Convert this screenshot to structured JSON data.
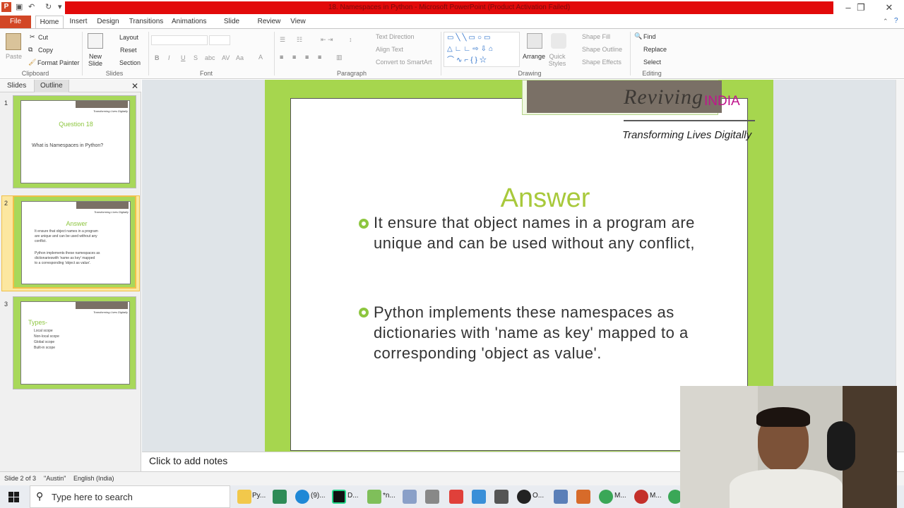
{
  "window": {
    "title": "18. Namespaces in Python - Microsoft PowerPoint (Product Activation Failed)"
  },
  "tabs": [
    "File",
    "Home",
    "Insert",
    "Design",
    "Transitions",
    "Animations",
    "Slide Show",
    "Review",
    "View"
  ],
  "ribbon": {
    "clipboard": {
      "paste": "Paste",
      "cut": "Cut",
      "copy": "Copy",
      "format_painter": "Format Painter",
      "group": "Clipboard"
    },
    "slides": {
      "new_slide": "New Slide",
      "layout": "Layout",
      "reset": "Reset",
      "section": "Section",
      "group": "Slides"
    },
    "font": {
      "group": "Font",
      "bold": "B",
      "italic": "I",
      "underline": "U",
      "strike": "S",
      "shadow": "abc",
      "spacing": "AV",
      "case": "Aa",
      "color": "A"
    },
    "paragraph": {
      "text_direction": "Text Direction",
      "align_text": "Align Text",
      "convert_smartart": "Convert to SmartArt",
      "group": "Paragraph"
    },
    "drawing": {
      "arrange": "Arrange",
      "quick_styles": "Quick Styles",
      "shape_fill": "Shape Fill",
      "shape_outline": "Shape Outline",
      "shape_effects": "Shape Effects",
      "group": "Drawing"
    },
    "editing": {
      "find": "Find",
      "replace": "Replace",
      "select": "Select",
      "group": "Editing"
    }
  },
  "left_pane": {
    "tabs": [
      "Slides",
      "Outline"
    ],
    "thumbnails": [
      {
        "num": "1",
        "title": "Question 18",
        "lines": [
          "What is Namespaces  in Python?"
        ]
      },
      {
        "num": "2",
        "title": "Answer",
        "lines": [
          "It ensure that object names in a program",
          "are unique and can be used without any",
          "conflict.",
          "",
          "Python implements these namespaces as",
          "dictionarieswith 'name as key' mapped",
          "to a corresponding 'object as value'."
        ]
      },
      {
        "num": "3",
        "title": "Types-",
        "lines": [
          "Local scope",
          "Non-local scope",
          "Global scope",
          "Built-in scope"
        ]
      }
    ]
  },
  "slide": {
    "logo": "Reviving",
    "logo_accent": "INDIA",
    "tagline": "Transforming Lives Digitally",
    "title": "Answer",
    "bullets": [
      "It ensure that object names in a program are unique and can be used without any conflict,",
      " Python implements these namespaces as dictionaries with 'name as key' mapped to a corresponding 'object as value'."
    ]
  },
  "notes": {
    "placeholder": "Click to add notes"
  },
  "status": {
    "slide": "Slide 2 of 3",
    "theme": "\"Austin\"",
    "language": "English (India)"
  },
  "taskbar": {
    "search_placeholder": "Type here to search",
    "apps": [
      "Py...",
      "(9)...",
      "D...",
      "*n...",
      "O...",
      "M...",
      "M..."
    ]
  },
  "colors": {
    "accent": "#8dc63f",
    "title_red": "#e20a0a",
    "file_tab": "#d24726",
    "india": "#c0148c"
  }
}
